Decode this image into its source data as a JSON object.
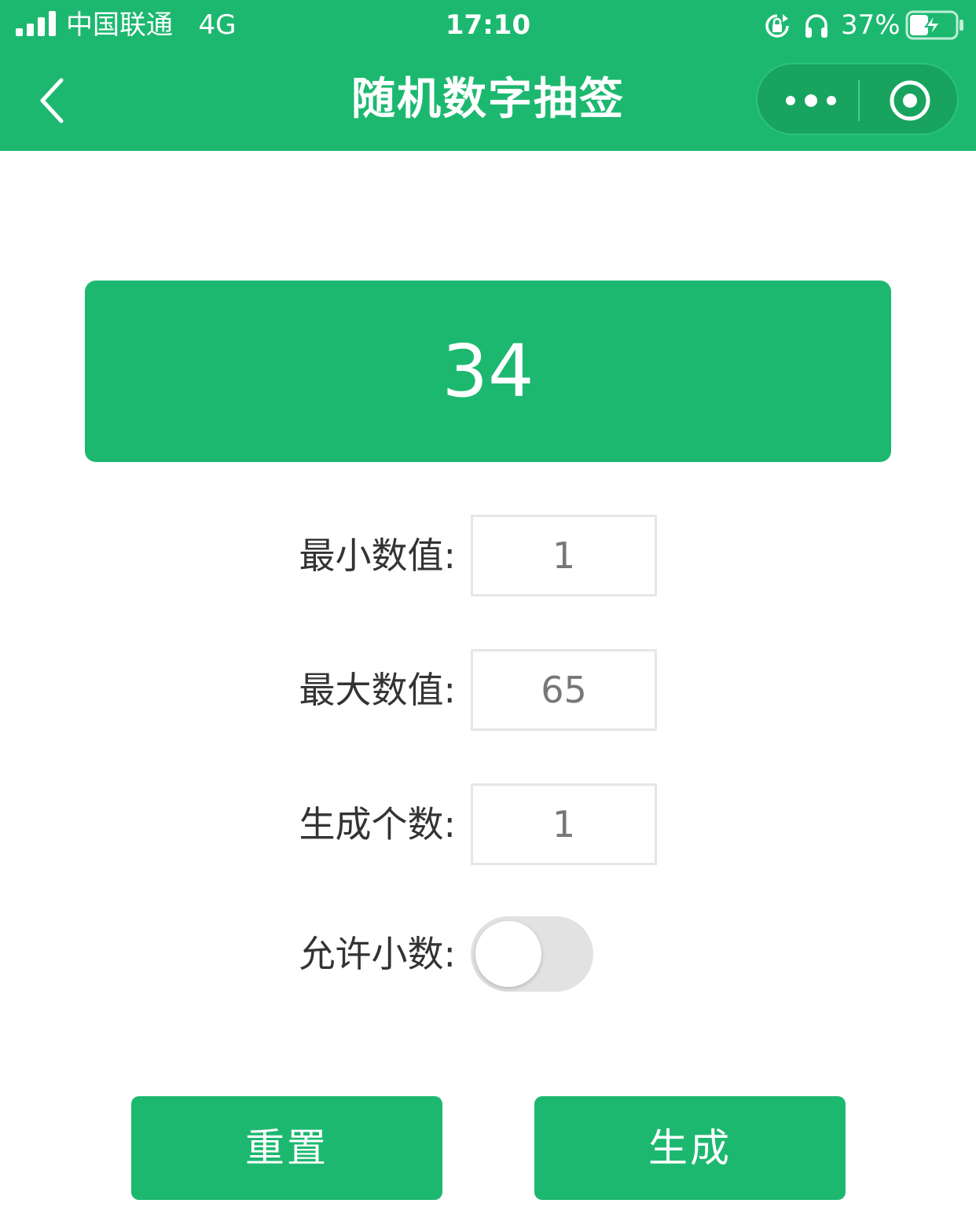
{
  "status_bar": {
    "carrier": "中国联通",
    "network": "4G",
    "time": "17:10",
    "battery_percent": "37%",
    "icons": [
      "signal-icon",
      "rotation-lock-icon",
      "headphones-icon",
      "battery-charging-icon"
    ]
  },
  "nav_bar": {
    "title": "随机数字抽签",
    "icons": [
      "back-arrow-icon",
      "more-dots-icon",
      "close-circle-icon"
    ]
  },
  "result": {
    "value": "34"
  },
  "form": {
    "min": {
      "label": "最小数值:",
      "value": "1"
    },
    "max": {
      "label": "最大数值:",
      "value": "65"
    },
    "count": {
      "label": "生成个数:",
      "value": "1"
    },
    "allow_decimal": {
      "label": "允许小数:",
      "checked": false
    }
  },
  "buttons": {
    "reset_label": "重置",
    "generate_label": "生成"
  },
  "colors": {
    "brand": "#1db870",
    "toggle_off": "#e2e2e2"
  }
}
